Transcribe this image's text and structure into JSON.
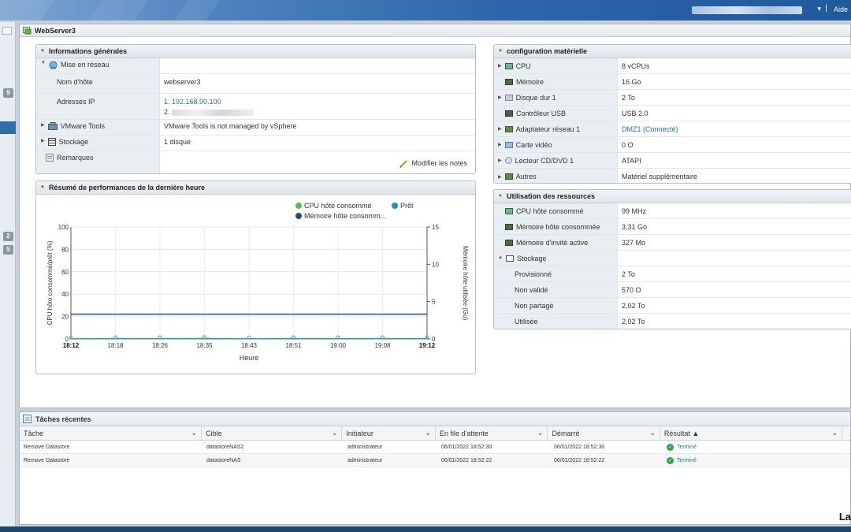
{
  "topbar": {
    "help": "Aide",
    "separator": "|",
    "caret": "▾"
  },
  "leftbar": {
    "badges": [
      "9",
      "2",
      "5"
    ]
  },
  "vm": {
    "name": "WebServer3"
  },
  "general": {
    "title": "Informations générales",
    "network_label": "Mise en réseau",
    "hostname_label": "Nom d'hôte",
    "hostname_value": "webserver3",
    "ip_label": "Adresses IP",
    "ip1": "1. 192.168.90.100",
    "ip2_prefix": "2.",
    "vmtools_label": "VMware Tools",
    "vmtools_value": "VMware Tools is not managed by vSphere",
    "storage_label": "Stockage",
    "storage_value": "1 disque",
    "notes_label": "Remarques",
    "edit_notes": "Modifier les notes"
  },
  "perf": {
    "title": "Résumé de performances de la dernière heure"
  },
  "hardware": {
    "title": "configuration matérielle",
    "rows": [
      {
        "label": "CPU",
        "value": "8 vCPUs",
        "icon": "cpu-icon"
      },
      {
        "label": "Mémoire",
        "value": "16 Go",
        "icon": "memory-icon"
      },
      {
        "label": "Disque dur 1",
        "value": "2 To",
        "icon": "disk-icon"
      },
      {
        "label": "Contrôleur USB",
        "value": "USB 2.0",
        "icon": "usb-icon"
      },
      {
        "label": "Adaptateur réseau 1",
        "value": "DMZ1 (Connecté)",
        "icon": "network-adapter-icon"
      },
      {
        "label": "Carte vidéo",
        "value": "0 O",
        "icon": "video-card-icon"
      },
      {
        "label": "Lecteur CD/DVD 1",
        "value": "ATAPI",
        "icon": "cd-dvd-icon"
      },
      {
        "label": "Autres",
        "value": "Matériel supplémentaire",
        "icon": "other-hardware-icon"
      }
    ]
  },
  "resources": {
    "title": "Utilisation des ressources",
    "rows": [
      {
        "label": "CPU hôte consommé",
        "value": "99 MHz"
      },
      {
        "label": "Mémoire hôte consommée",
        "value": "3,31 Go"
      },
      {
        "label": "Mémoire d'invité active",
        "value": "327 Mo"
      },
      {
        "label": "Stockage",
        "value": ""
      },
      {
        "label": "Provisionné",
        "value": "2 To"
      },
      {
        "label": "Non validé",
        "value": "570 O"
      },
      {
        "label": "Non partagé",
        "value": "2,02 To"
      },
      {
        "label": "Utilisée",
        "value": "2,02 To"
      }
    ]
  },
  "tasks": {
    "title": "Tâches récentes",
    "columns": [
      "Tâche",
      "Cible",
      "Initiateur",
      "En file d'attente",
      "Démarré",
      "Résultat ▲"
    ],
    "rows": [
      [
        "Remove Datastore",
        "datastoreNAS2",
        "administrateur",
        "06/01/2022 18:52:30",
        "06/01/2022 18:52:30",
        "Terminé"
      ],
      [
        "Remove Datastore",
        "datastoreNAS",
        "administrateur",
        "06/01/2022 18:52:22",
        "06/01/2022 18:52:22",
        "Terminé"
      ]
    ]
  },
  "corner_text": "La",
  "chart_data": {
    "type": "line",
    "legend": [
      "CPU hôte consommé",
      "Prêt",
      "Mémoire hôte consomm..."
    ],
    "legend_colors": [
      "#5cb85c",
      "#1e90c8",
      "#1f4e79"
    ],
    "xlabel": "Heure",
    "ylabel_left": "CPU hôte consommé/prêt (%)",
    "ylabel_right": "Mémoire hôte utilisée (Go)",
    "x_ticks": [
      "18:12",
      "18:18",
      "18:26",
      "18:35",
      "18:43",
      "18:51",
      "19:00",
      "19:08",
      "19:12"
    ],
    "y_left_ticks": [
      "0",
      "20",
      "40",
      "60",
      "80",
      "100"
    ],
    "y_right_ticks": [
      "0",
      "5",
      "10",
      "15"
    ],
    "ylim_left": [
      0,
      100
    ],
    "ylim_right": [
      0,
      15
    ],
    "series": [
      {
        "name": "Mémoire hôte consomm...",
        "axis": "right",
        "values": [
          3.31,
          3.31,
          3.31,
          3.31,
          3.31,
          3.31,
          3.31,
          3.31,
          3.31
        ]
      },
      {
        "name": "CPU hôte consommé",
        "axis": "left",
        "values": [
          0.3,
          0.5,
          0.4,
          0.6,
          0.3,
          0.5,
          0.4,
          0.5,
          0.4
        ]
      },
      {
        "name": "Prêt",
        "axis": "left",
        "values": [
          0.1,
          0.1,
          0.1,
          0.1,
          0.1,
          0.1,
          0.1,
          0.1,
          0.1
        ]
      }
    ],
    "grid": true
  }
}
